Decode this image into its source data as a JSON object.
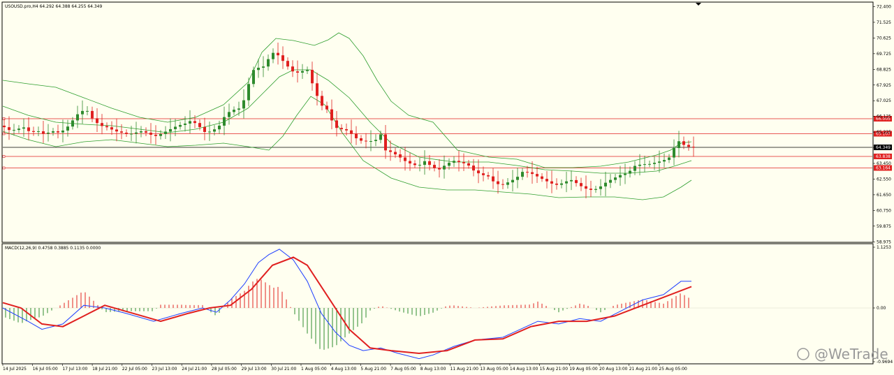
{
  "price_panel": {
    "header": "USOUSD.pro,H4  64.292 64.388 64.255 64.349",
    "y_ticks": [
      "72.400",
      "71.525",
      "70.625",
      "69.725",
      "68.825",
      "67.925",
      "67.025",
      "66.125",
      "65.225",
      "64.325",
      "63.450",
      "62.550",
      "61.650",
      "60.750",
      "59.875",
      "58.975"
    ],
    "current_price": "64.349",
    "levels": [
      {
        "label": "66.005",
        "color": "#e02020"
      },
      {
        "label": "65.107",
        "color": "#e02020"
      },
      {
        "label": "63.838",
        "color": "#e02020"
      },
      {
        "label": "63.164",
        "color": "#e02020"
      }
    ]
  },
  "macd_panel": {
    "header": "MACD(12,26,9) 0.4758 0.3885 0.1135 0.0000",
    "y_ticks": [
      "1.1253",
      "0.00",
      "-0.9694"
    ]
  },
  "time_axis": [
    "14 Jul 2025",
    "16 Jul 05:00",
    "17 Jul 13:00",
    "18 Jul 21:00",
    "22 Jul 05:00",
    "23 Jul 13:00",
    "24 Jul 21:00",
    "28 Jul 05:00",
    "29 Jul 13:00",
    "30 Jul 21:00",
    "1 Aug 05:00",
    "4 Aug 13:00",
    "5 Aug 21:00",
    "7 Aug 05:00",
    "8 Aug 13:00",
    "11 Aug 21:00",
    "13 Aug 05:00",
    "14 Aug 13:00",
    "15 Aug 21:00",
    "19 Aug 05:00",
    "20 Aug 13:00",
    "21 Aug 21:00",
    "25 Aug 05:00"
  ],
  "watermark": "@WeTrade",
  "colors": {
    "background": "#fffff0",
    "bull": "#2e8b2e",
    "bear": "#e02020",
    "bands": "#2e9e2e",
    "macd_line": "#2040ff",
    "signal_line": "#e02020",
    "level": "#e02020"
  }
}
